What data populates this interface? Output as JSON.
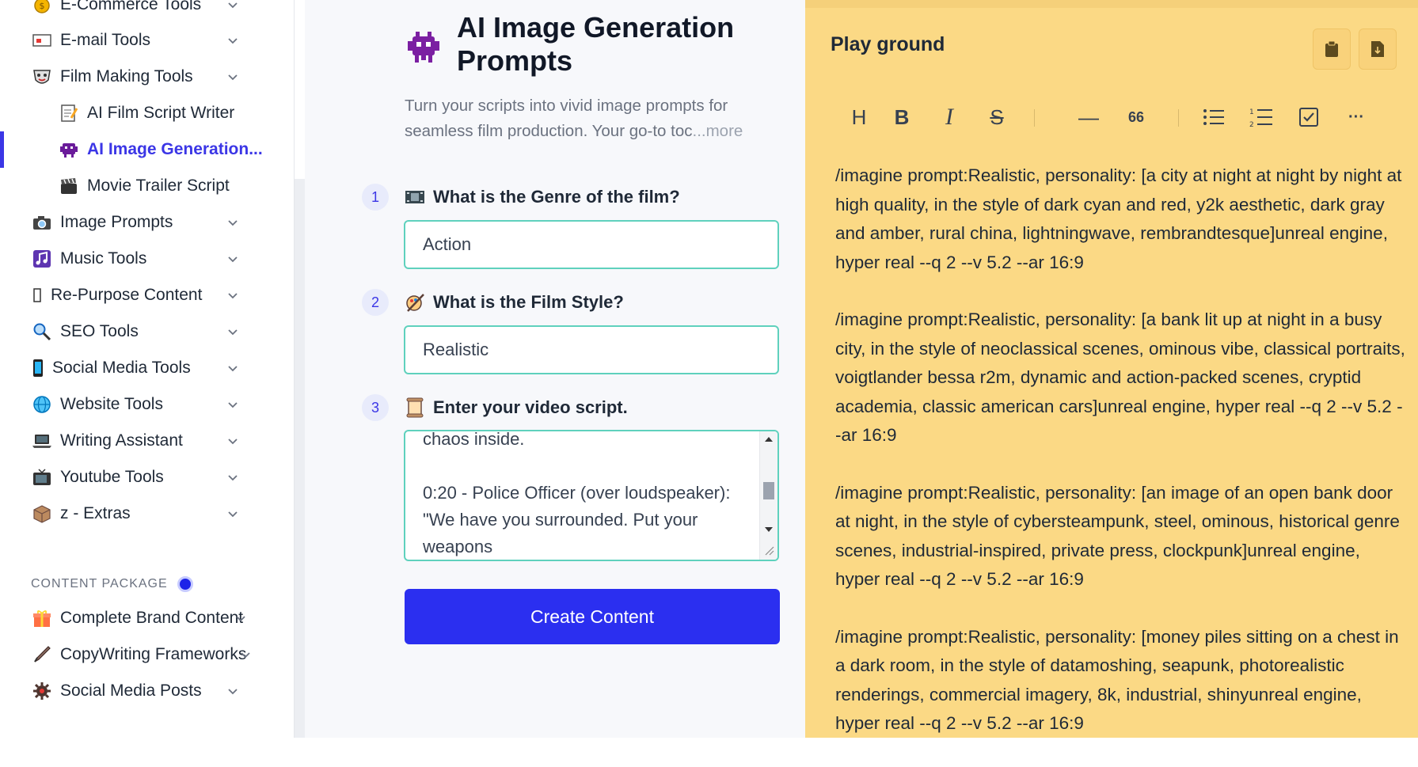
{
  "sidebar": {
    "items": [
      {
        "label": "E-Commerce Tools",
        "icon": "money-bag-icon"
      },
      {
        "label": "E-mail Tools",
        "icon": "email-icon"
      },
      {
        "label": "Film Making Tools",
        "icon": "film-mask-icon"
      },
      {
        "label": "AI Film Script Writer",
        "icon": "memo-icon"
      },
      {
        "label": "AI Image Generation...",
        "icon": "alien-monster-icon"
      },
      {
        "label": "Movie Trailer Script",
        "icon": "clapper-icon"
      },
      {
        "label": "Image Prompts",
        "icon": "camera-icon"
      },
      {
        "label": "Music Tools",
        "icon": "music-notes-icon"
      },
      {
        "label": "Re-Purpose Content",
        "icon": "missing-glyph-icon"
      },
      {
        "label": "SEO Tools",
        "icon": "magnifier-icon"
      },
      {
        "label": "Social Media Tools",
        "icon": "phone-icon"
      },
      {
        "label": "Website Tools",
        "icon": "globe-icon"
      },
      {
        "label": "Writing Assistant",
        "icon": "laptop-icon"
      },
      {
        "label": "Youtube Tools",
        "icon": "tv-icon"
      },
      {
        "label": "z - Extras",
        "icon": "package-icon"
      }
    ],
    "section_label": "CONTENT PACKAGE",
    "package_items": [
      {
        "label": "Complete Brand Content",
        "icon": "gift-icon"
      },
      {
        "label": "CopyWriting Frameworks",
        "icon": "fountain-pen-icon"
      },
      {
        "label": "Social Media Posts",
        "icon": "puzzle-gear-icon"
      }
    ]
  },
  "tool": {
    "title": "AI Image Generation Prompts",
    "description": "Turn your scripts into vivid image prompts for seamless film production. Your go-to toc",
    "more": "...more",
    "questions": [
      {
        "number": "1",
        "label": "What is the Genre of the film?",
        "value": "Action"
      },
      {
        "number": "2",
        "label": "What is the Film Style?",
        "value": "Realistic"
      },
      {
        "number": "3",
        "label": "Enter your video script.",
        "value": "chaos inside.\n\n0:20 - Police Officer (over loudspeaker): \"We have you surrounded. Put your weapons"
      }
    ],
    "button_label": "Create Content"
  },
  "playground": {
    "title": "Play ground",
    "paragraphs": [
      "/imagine prompt:Realistic, personality: [a city at night at night by night at high quality, in the style of dark cyan and red, y2k aesthetic, dark gray and amber, rural china, lightningwave, rembrandtesque]unreal engine, hyper real --q 2 --v 5.2 --ar 16:9",
      "/imagine prompt:Realistic, personality: [a bank lit up at night in a busy city, in the style of neoclassical scenes, ominous vibe, classical portraits, voigtlander bessa r2m, dynamic and action-packed scenes, cryptid academia, classic american cars]unreal engine, hyper real --q 2 --v 5.2 --ar 16:9",
      "/imagine prompt:Realistic, personality: [an image of an open bank door at night, in the style of cybersteampunk, steel, ominous, historical genre scenes, industrial-inspired, private press, clockpunk]unreal engine, hyper real --q 2 --v 5.2 --ar 16:9",
      "/imagine prompt:Realistic, personality: [money piles sitting on a chest in a dark room, in the style of datamoshing, seapunk, photorealistic renderings, commercial imagery, 8k, industrial, shinyunreal engine, hyper real --q 2 --v 5.2 --ar 16:9"
    ],
    "toolbar": {
      "heading": "H",
      "bold": "B",
      "italic": "I",
      "strike": "S",
      "hr": "—",
      "quote": "66",
      "more": "···"
    }
  }
}
